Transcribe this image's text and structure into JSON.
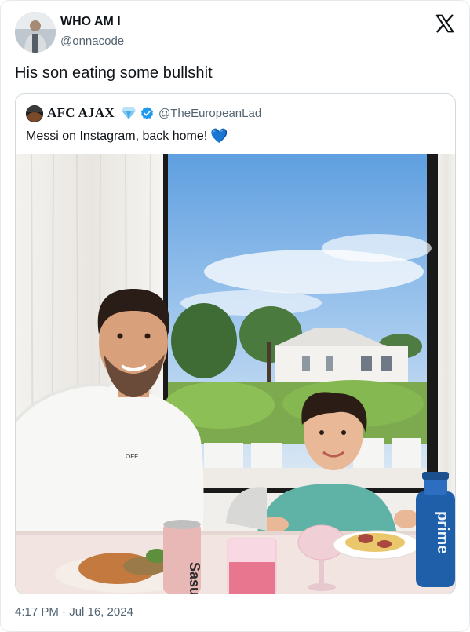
{
  "tweet": {
    "author_name": "WHO AM I",
    "author_handle": "@onnacode",
    "text": "His son eating some bullshit",
    "timestamp": "4:17 PM · Jul 16, 2024",
    "avatar_icon": "profile-avatar",
    "brand_icon": "x-logo-icon"
  },
  "quoted_tweet": {
    "author_name": "AFC AJAX",
    "author_handle": "@TheEuropeanLad",
    "text": "Messi on Instagram, back home!",
    "emoji_heart": "💙",
    "badges": [
      "diamond-icon",
      "verified-badge-icon"
    ],
    "verified_color": "#1d9bf0",
    "bottle_label": "prime",
    "can_label": "Sasu"
  }
}
